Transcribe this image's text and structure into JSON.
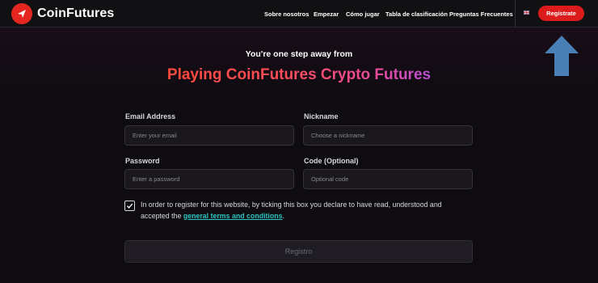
{
  "header": {
    "brand": "CoinFutures",
    "nav": [
      "Sobre nosotros",
      "Empezar",
      "Cómo jugar",
      "Tabla de clasificación",
      "Preguntas Frecuentes"
    ],
    "register_label": "Regístrate",
    "language_flag": "uk-flag-icon"
  },
  "hero": {
    "subtitle": "You're one step away from",
    "title": "Playing CoinFutures Crypto Futures"
  },
  "form": {
    "email_label": "Email Address",
    "email_placeholder": "Enter your email",
    "email_value": "",
    "nickname_label": "Nickname",
    "nickname_placeholder": "Choose a nickname",
    "nickname_value": "",
    "password_label": "Password",
    "password_placeholder": "Enter a password",
    "password_value": "",
    "code_label": "Code (Optional)",
    "code_placeholder": "Optional code",
    "code_value": "",
    "terms_checked": true,
    "terms_text_before": "In order to register for this website, by ticking this box you declare to have read, understood and accepted the ",
    "terms_link": "general terms and conditions",
    "terms_text_after": ".",
    "submit_label": "Registro"
  },
  "colors": {
    "brand_red": "#dc1c1c",
    "link_teal": "#2cc4c3",
    "arrow_blue": "#4a7fb5",
    "background": "#0e0c10"
  },
  "annotation": {
    "arrow": "up-arrow-icon"
  }
}
